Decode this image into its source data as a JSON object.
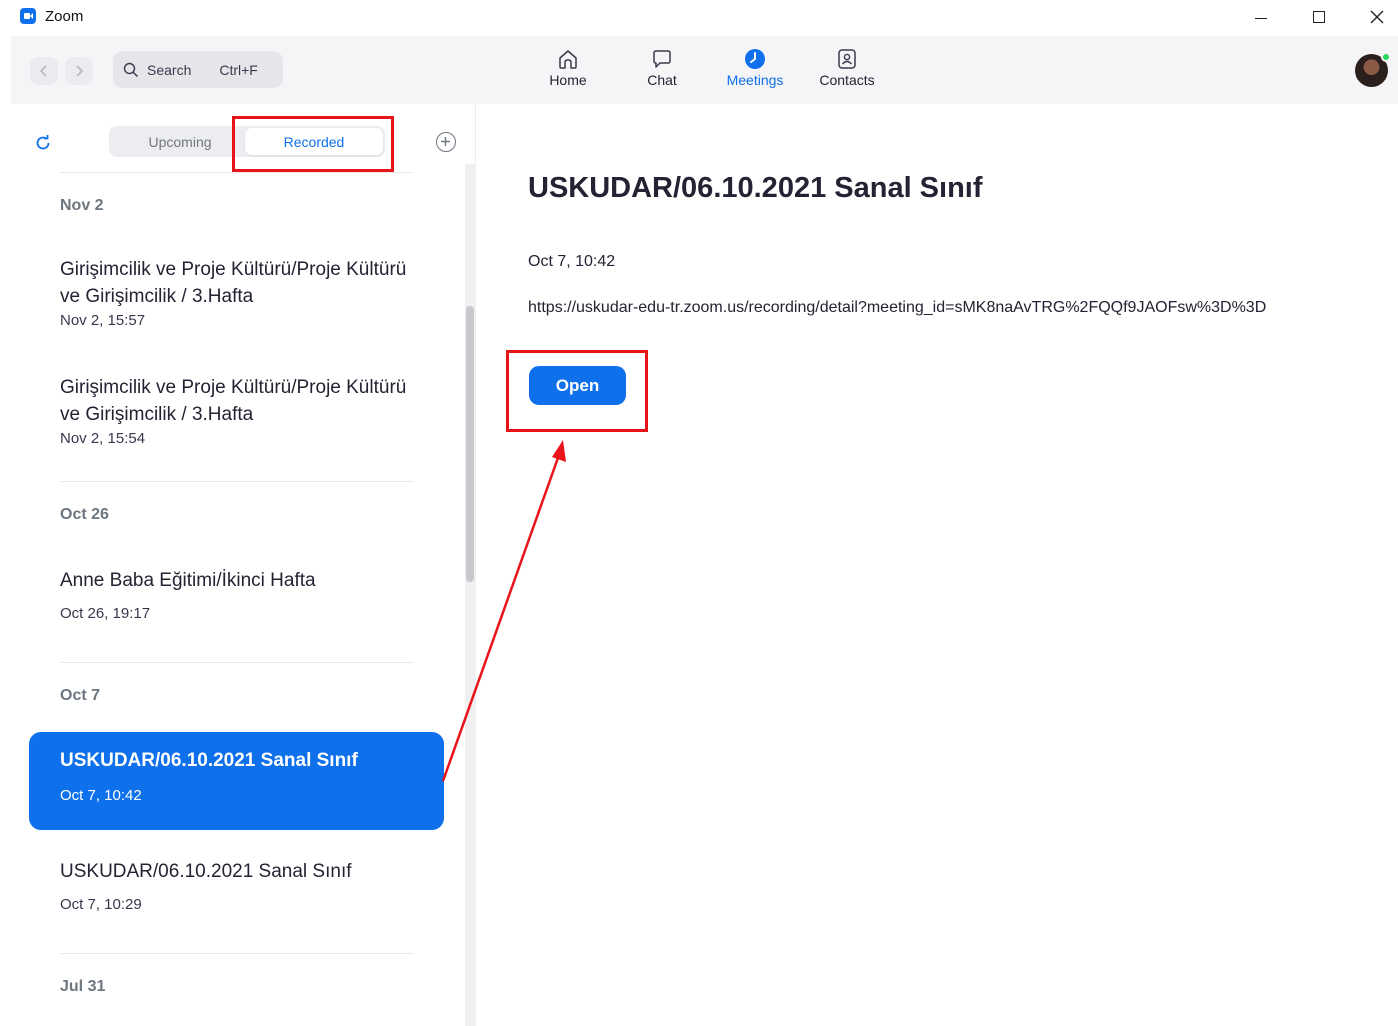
{
  "window": {
    "title": "Zoom",
    "minimize_icon": "minimize-icon",
    "maximize_icon": "maximize-icon",
    "close_icon": "close-icon"
  },
  "toolbar": {
    "search_placeholder": "Search",
    "search_shortcut": "Ctrl+F",
    "nav": [
      {
        "label": "Home",
        "icon": "home-icon",
        "active": false
      },
      {
        "label": "Chat",
        "icon": "chat-icon",
        "active": false
      },
      {
        "label": "Meetings",
        "icon": "clock-icon",
        "active": true
      },
      {
        "label": "Contacts",
        "icon": "contacts-icon",
        "active": false
      }
    ]
  },
  "left_panel": {
    "tabs": {
      "upcoming": "Upcoming",
      "recorded": "Recorded"
    },
    "groups": [
      {
        "label": "Nov 2",
        "items": [
          {
            "title": "Girişimcilik ve Proje Kültürü/Proje Kültürü ve Girişimcilik / 3.Hafta",
            "date": "Nov 2, 15:57"
          },
          {
            "title": "Girişimcilik ve Proje Kültürü/Proje Kültürü ve Girişimcilik / 3.Hafta",
            "date": "Nov 2, 15:54"
          }
        ]
      },
      {
        "label": "Oct 26",
        "items": [
          {
            "title": "Anne Baba Eğitimi/İkinci Hafta",
            "date": "Oct 26, 19:17"
          }
        ]
      },
      {
        "label": "Oct 7",
        "items": [
          {
            "title": "USKUDAR/06.10.2021 Sanal Sınıf",
            "date": "Oct 7, 10:42",
            "selected": true
          },
          {
            "title": "USKUDAR/06.10.2021 Sanal Sınıf",
            "date": "Oct 7, 10:29"
          }
        ]
      },
      {
        "label": "Jul 31",
        "items": []
      }
    ]
  },
  "detail": {
    "title": "USKUDAR/06.10.2021 Sanal Sınıf",
    "date": "Oct 7, 10:42",
    "url": "https://uskudar-edu-tr.zoom.us/recording/detail?meeting_id=sMK8naAvTRG%2FQQf9JAOFsw%3D%3D",
    "open_label": "Open"
  },
  "colors": {
    "accent": "#0e71eb",
    "annotation": "#e8141a"
  }
}
